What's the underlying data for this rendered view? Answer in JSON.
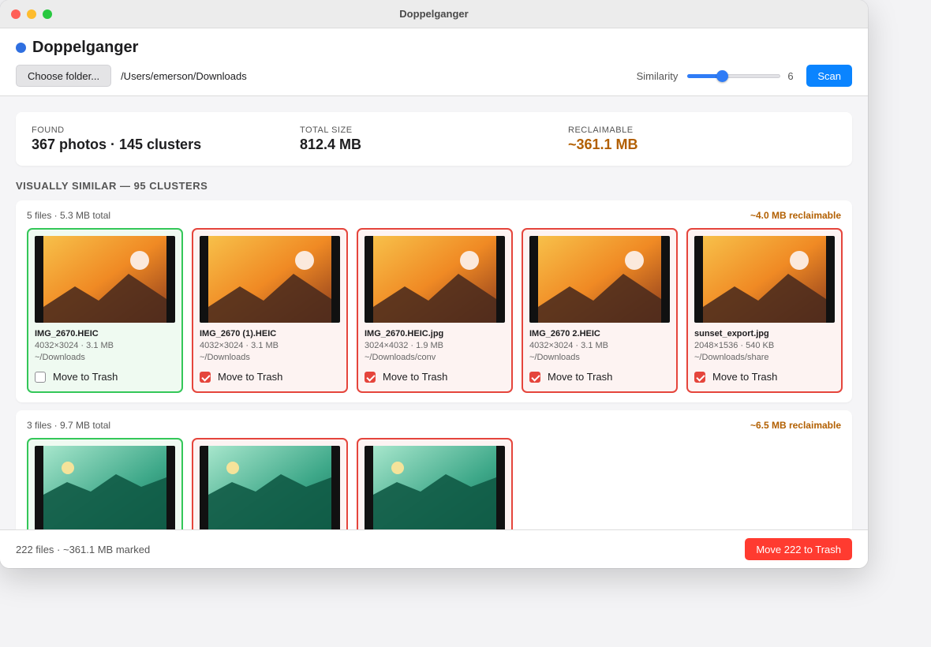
{
  "window": {
    "title": "Doppelganger"
  },
  "app": {
    "title": "Doppelganger",
    "accent": "#2f6fe0"
  },
  "toolbar": {
    "choose_label": "Choose folder...",
    "folder_path": "/Users/emerson/Downloads",
    "similarity_label": "Similarity",
    "similarity_value": "6",
    "similarity_fraction": 0.32,
    "scan_label": "Scan"
  },
  "summary": {
    "found_label": "FOUND",
    "found_value": "367 photos · 145 clusters",
    "size_label": "TOTAL SIZE",
    "size_value": "812.4 MB",
    "reclaim_label": "RECLAIMABLE",
    "reclaim_value": "~361.1 MB"
  },
  "section": {
    "title": "VISUALLY SIMILAR — 95 CLUSTERS"
  },
  "clusters": [
    {
      "info": "5 files · 5.3 MB total",
      "reclaim": "~4.0 MB reclaimable",
      "theme": "sunset",
      "files": [
        {
          "name": "IMG_2670.HEIC",
          "meta": "4032×3024 · 3.1 MB",
          "path": "~/Downloads",
          "trash_label": "Move to Trash",
          "marked": false
        },
        {
          "name": "IMG_2670 (1).HEIC",
          "meta": "4032×3024 · 3.1 MB",
          "path": "~/Downloads",
          "trash_label": "Move to Trash",
          "marked": true
        },
        {
          "name": "IMG_2670.HEIC.jpg",
          "meta": "3024×4032 · 1.9 MB",
          "path": "~/Downloads/conv",
          "trash_label": "Move to Trash",
          "marked": true
        },
        {
          "name": "IMG_2670 2.HEIC",
          "meta": "4032×3024 · 3.1 MB",
          "path": "~/Downloads",
          "trash_label": "Move to Trash",
          "marked": true
        },
        {
          "name": "sunset_export.jpg",
          "meta": "2048×1536 · 540 KB",
          "path": "~/Downloads/share",
          "trash_label": "Move to Trash",
          "marked": true
        }
      ]
    },
    {
      "info": "3 files · 9.7 MB total",
      "reclaim": "~6.5 MB reclaimable",
      "theme": "forest",
      "files": [
        {
          "marked": false
        },
        {
          "marked": true
        },
        {
          "marked": true
        }
      ]
    }
  ],
  "footer": {
    "status": "222 files · ~361.1 MB marked",
    "trash_button": "Move 222 to Trash"
  },
  "colors": {
    "keep_border": "#34c759",
    "delete_border": "#e5453c",
    "reclaim_text": "#b25f00",
    "primary_button": "#0a84ff",
    "danger_button": "#ff3b30"
  }
}
